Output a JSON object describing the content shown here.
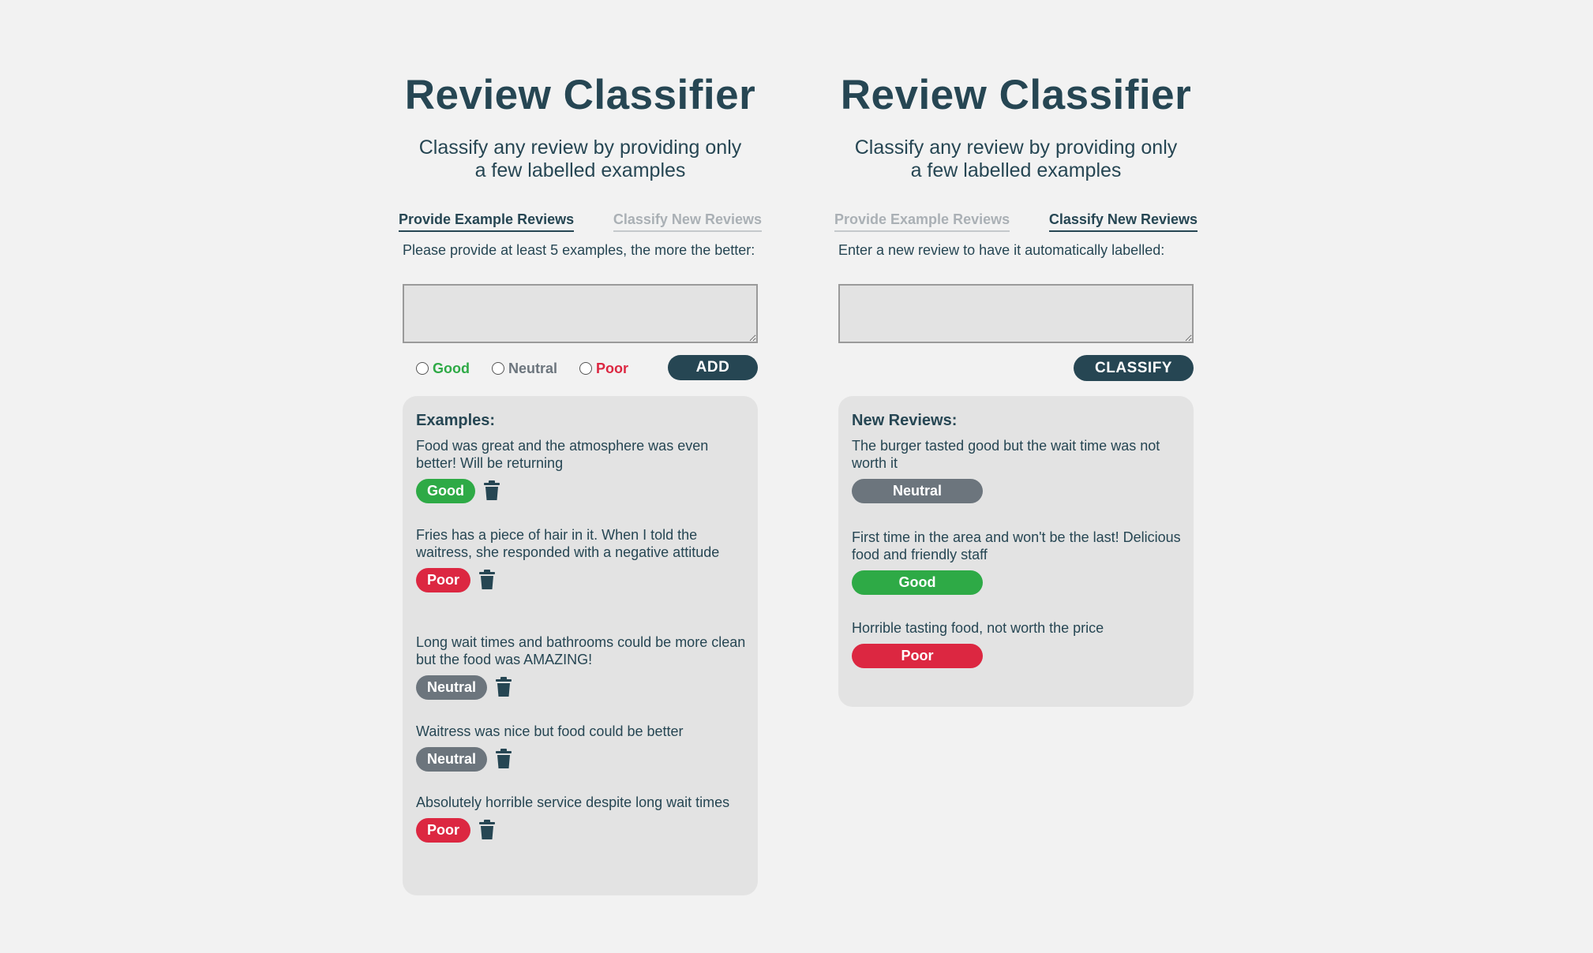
{
  "left_panel": {
    "title": "Review Classifier",
    "subtitle_line1": "Classify any review by providing only",
    "subtitle_line2": "a few labelled examples",
    "tabs": [
      {
        "label": "Provide Example Reviews",
        "active": true
      },
      {
        "label": "Classify New Reviews",
        "active": false
      }
    ],
    "instructions": "Please provide at least 5 examples, the more the better:",
    "radio_options": [
      {
        "label": "Good",
        "selected": false
      },
      {
        "label": "Neutral",
        "selected": false
      },
      {
        "label": "Poor",
        "selected": false
      }
    ],
    "add_button": "ADD",
    "list_heading": "Examples:",
    "examples": [
      {
        "text": "Food was great and the atmosphere was even better! Will be returning",
        "label": "Good"
      },
      {
        "text": "Fries has a piece of hair in it. When I told the waitress, she responded with a negative attitude",
        "label": "Poor"
      },
      {
        "text": "Long wait times and bathrooms could be more clean but the food was AMAZING!",
        "label": "Neutral"
      },
      {
        "text": "Waitress was nice but food could be better",
        "label": "Neutral"
      },
      {
        "text": "Absolutely horrible service despite long wait times",
        "label": "Poor"
      }
    ]
  },
  "right_panel": {
    "title": "Review Classifier",
    "subtitle_line1": "Classify any review by providing only",
    "subtitle_line2": "a few labelled examples",
    "tabs": [
      {
        "label": "Provide Example Reviews",
        "active": false
      },
      {
        "label": "Classify New Reviews",
        "active": true
      }
    ],
    "instructions": "Enter a new review to have it automatically labelled:",
    "classify_button": "CLASSIFY",
    "list_heading": "New Reviews:",
    "reviews": [
      {
        "text": "The burger tasted good but the wait time was not worth it",
        "label": "Neutral"
      },
      {
        "text": "First time in the area and won't be the last! Delicious food and friendly staff",
        "label": "Good"
      },
      {
        "text": "Horrible tasting food, not worth the price",
        "label": "Poor"
      }
    ]
  },
  "colors": {
    "primary": "#264653",
    "good": "#2eaa46",
    "neutral": "#6c757d",
    "poor": "#dc2741",
    "background": "#f2f2f2",
    "box": "#e3e3e3"
  },
  "icons": {
    "delete": "trash-icon"
  }
}
